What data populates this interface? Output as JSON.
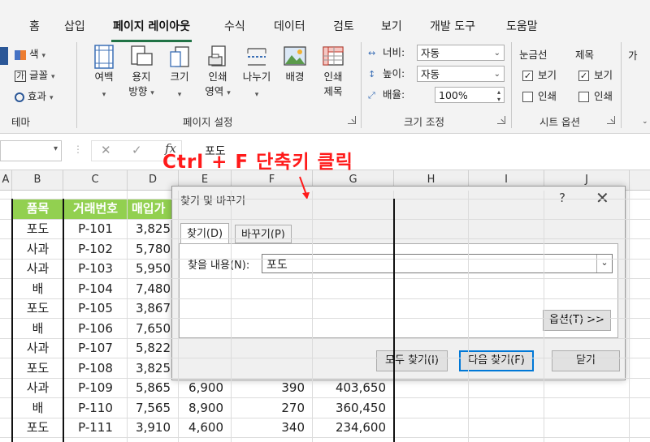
{
  "ribbon": {
    "tabs": [
      "홈",
      "삽입",
      "페이지 레이아웃",
      "수식",
      "데이터",
      "검토",
      "보기",
      "개발 도구",
      "도움말"
    ],
    "active_tab": "페이지 레이아웃",
    "theme_group": {
      "colors": "색",
      "fonts": "글꼴",
      "effects": "효과",
      "label": "테마"
    },
    "page_setup": {
      "margins": "여백",
      "orientation": [
        "용지",
        "방향"
      ],
      "size": "크기",
      "print_area": [
        "인쇄",
        "영역"
      ],
      "breaks": "나누기",
      "background": "배경",
      "print_titles": [
        "인쇄",
        "제목"
      ],
      "label": "페이지 설정"
    },
    "scale_to_fit": {
      "width_label": "너비:",
      "width_value": "자동",
      "height_label": "높이:",
      "height_value": "자동",
      "scale_label": "배율:",
      "scale_value": "100%",
      "label": "크기 조정"
    },
    "sheet_options": {
      "gridlines": "눈금선",
      "headings": "제목",
      "view": "보기",
      "print": "인쇄",
      "gridlines_view": true,
      "gridlines_print": false,
      "headings_view": true,
      "headings_print": false,
      "label": "시트 옵션"
    },
    "arrange_cut": "가"
  },
  "formula_bar": {
    "cancel": "✕",
    "enter": "✓",
    "fx": "fx",
    "content": "포도"
  },
  "columns": [
    "A",
    "B",
    "C",
    "D",
    "E",
    "F",
    "G",
    "H",
    "I",
    "J"
  ],
  "table": {
    "headers": [
      "품목",
      "거래번호",
      "매입가"
    ],
    "rows": [
      [
        "포도",
        "P-101",
        "3,825",
        "",
        "",
        ""
      ],
      [
        "사과",
        "P-102",
        "5,780",
        "",
        "",
        ""
      ],
      [
        "사과",
        "P-103",
        "5,950",
        "",
        "",
        ""
      ],
      [
        "배",
        "P-104",
        "7,480",
        "",
        "",
        ""
      ],
      [
        "포도",
        "P-105",
        "3,867",
        "",
        "",
        ""
      ],
      [
        "배",
        "P-106",
        "7,650",
        "",
        "",
        ""
      ],
      [
        "사과",
        "P-107",
        "5,822",
        "",
        "",
        ""
      ],
      [
        "포도",
        "P-108",
        "3,825",
        "",
        "",
        ""
      ],
      [
        "사과",
        "P-109",
        "5,865",
        "6,900",
        "390",
        "403,650"
      ],
      [
        "배",
        "P-110",
        "7,565",
        "8,900",
        "270",
        "360,450"
      ],
      [
        "포도",
        "P-111",
        "3,910",
        "4,600",
        "340",
        "234,600"
      ]
    ]
  },
  "dialog": {
    "title": "찾기 및 바꾸기",
    "help": "?",
    "close": "✕",
    "tab_find": "찾기(D)",
    "tab_replace": "바꾸기(P)",
    "find_label": "찾을 내용(N):",
    "find_value": "포도",
    "options_btn": "옵션(T) >>",
    "find_all_btn": "모두 찾기(I)",
    "find_next_btn": "다음 찾기(F)",
    "close_btn": "닫기"
  },
  "annotation": {
    "text": "Ctrl + F 단축키 클릭",
    "color": "#ff1a1a"
  },
  "colors": {
    "accent": "#217346",
    "header_fill": "#92d050",
    "focus": "#0078d7"
  }
}
